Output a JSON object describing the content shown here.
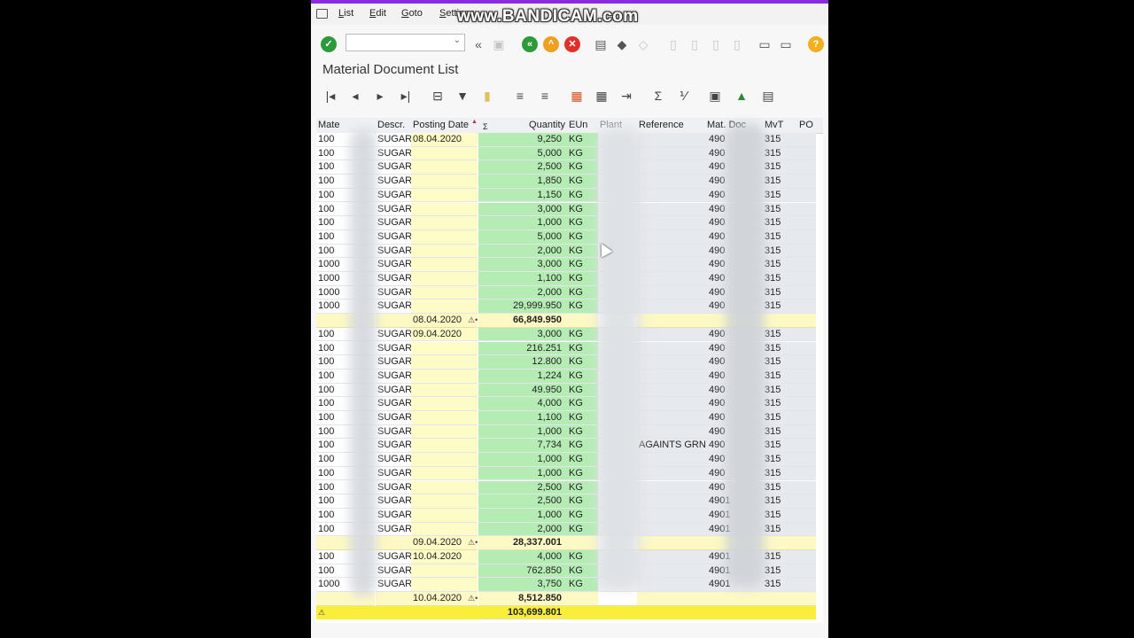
{
  "watermark": "www.BANDICAM.com",
  "menu": [
    "List",
    "Edit",
    "Goto",
    "Settings"
  ],
  "page_title": "Material Document List",
  "columns": [
    {
      "key": "material",
      "label": "Mate"
    },
    {
      "key": "descr",
      "label": "Descr."
    },
    {
      "key": "posting_date",
      "label": "Posting Date"
    },
    {
      "key": "sum_marker",
      "label": "Σ"
    },
    {
      "key": "quantity",
      "label": "Quantity"
    },
    {
      "key": "eun",
      "label": "EUn"
    },
    {
      "key": "plant",
      "label": "Plant"
    },
    {
      "key": "reference",
      "label": "Reference"
    },
    {
      "key": "mat_doc",
      "label": "Mat. Doc"
    },
    {
      "key": "mvt",
      "label": "MvT"
    },
    {
      "key": "po",
      "label": "PO"
    }
  ],
  "rows": [
    {
      "type": "item",
      "material": "100",
      "descr": "SUGAR",
      "date": "08.04.2020",
      "qty": "9,250",
      "eun": "KG",
      "ref": "",
      "matdoc": "490",
      "mvt": "315"
    },
    {
      "type": "item",
      "material": "100",
      "descr": "SUGAR",
      "date": "",
      "qty": "5,000",
      "eun": "KG",
      "ref": "",
      "matdoc": "490",
      "mvt": "315"
    },
    {
      "type": "item",
      "material": "100",
      "descr": "SUGAR",
      "date": "",
      "qty": "2,500",
      "eun": "KG",
      "ref": "",
      "matdoc": "490",
      "mvt": "315"
    },
    {
      "type": "item",
      "material": "100",
      "descr": "SUGAR",
      "date": "",
      "qty": "1,850",
      "eun": "KG",
      "ref": "",
      "matdoc": "490",
      "mvt": "315"
    },
    {
      "type": "item",
      "material": "100",
      "descr": "SUGAR",
      "date": "",
      "qty": "1,150",
      "eun": "KG",
      "ref": "",
      "matdoc": "490",
      "mvt": "315"
    },
    {
      "type": "item",
      "material": "100",
      "descr": "SUGAR",
      "date": "",
      "qty": "3,000",
      "eun": "KG",
      "ref": "",
      "matdoc": "490",
      "mvt": "315"
    },
    {
      "type": "item",
      "material": "100",
      "descr": "SUGAR",
      "date": "",
      "qty": "1,000",
      "eun": "KG",
      "ref": "",
      "matdoc": "490",
      "mvt": "315"
    },
    {
      "type": "item",
      "material": "100",
      "descr": "SUGAR",
      "date": "",
      "qty": "5,000",
      "eun": "KG",
      "ref": "",
      "matdoc": "490",
      "mvt": "315"
    },
    {
      "type": "item",
      "material": "100",
      "descr": "SUGAR",
      "date": "",
      "qty": "2,000",
      "eun": "KG",
      "ref": "",
      "matdoc": "490",
      "mvt": "315"
    },
    {
      "type": "item",
      "material": "1000",
      "descr": "SUGAR",
      "date": "",
      "qty": "3,000",
      "eun": "KG",
      "ref": "",
      "matdoc": "490",
      "mvt": "315"
    },
    {
      "type": "item",
      "material": "1000",
      "descr": "SUGAR",
      "date": "",
      "qty": "1,100",
      "eun": "KG",
      "ref": "",
      "matdoc": "490",
      "mvt": "315"
    },
    {
      "type": "item",
      "material": "1000",
      "descr": "SUGAR",
      "date": "",
      "qty": "2,000",
      "eun": "KG",
      "ref": "",
      "matdoc": "490",
      "mvt": "315"
    },
    {
      "type": "item",
      "material": "1000",
      "descr": "SUGAR",
      "date": "",
      "qty": "29,999.950",
      "eun": "KG",
      "ref": "",
      "matdoc": "490",
      "mvt": "315"
    },
    {
      "type": "subtotal",
      "date": "08.04.2020",
      "qty": "66,849.950"
    },
    {
      "type": "item",
      "material": "100",
      "descr": "SUGAR",
      "date": "09.04.2020",
      "qty": "3,000",
      "eun": "KG",
      "ref": "",
      "matdoc": "490",
      "mvt": "315"
    },
    {
      "type": "item",
      "material": "100",
      "descr": "SUGAR",
      "date": "",
      "qty": "216.251",
      "eun": "KG",
      "ref": "",
      "matdoc": "490",
      "mvt": "315"
    },
    {
      "type": "item",
      "material": "100",
      "descr": "SUGAR",
      "date": "",
      "qty": "12.800",
      "eun": "KG",
      "ref": "",
      "matdoc": "490",
      "mvt": "315"
    },
    {
      "type": "item",
      "material": "100",
      "descr": "SUGAR",
      "date": "",
      "qty": "1,224",
      "eun": "KG",
      "ref": "",
      "matdoc": "490",
      "mvt": "315"
    },
    {
      "type": "item",
      "material": "100",
      "descr": "SUGAR",
      "date": "",
      "qty": "49.950",
      "eun": "KG",
      "ref": "",
      "matdoc": "490",
      "mvt": "315"
    },
    {
      "type": "item",
      "material": "100",
      "descr": "SUGAR",
      "date": "",
      "qty": "4,000",
      "eun": "KG",
      "ref": "",
      "matdoc": "490",
      "mvt": "315"
    },
    {
      "type": "item",
      "material": "100",
      "descr": "SUGAR",
      "date": "",
      "qty": "1,100",
      "eun": "KG",
      "ref": "",
      "matdoc": "490",
      "mvt": "315"
    },
    {
      "type": "item",
      "material": "100",
      "descr": "SUGAR",
      "date": "",
      "qty": "1,000",
      "eun": "KG",
      "ref": "",
      "matdoc": "490",
      "mvt": "315"
    },
    {
      "type": "item",
      "material": "100",
      "descr": "SUGAR",
      "date": "",
      "qty": "7,734",
      "eun": "KG",
      "ref": "AGAINTS GRN",
      "matdoc": "490",
      "mvt": "315"
    },
    {
      "type": "item",
      "material": "100",
      "descr": "SUGAR",
      "date": "",
      "qty": "1,000",
      "eun": "KG",
      "ref": "",
      "matdoc": "490",
      "mvt": "315"
    },
    {
      "type": "item",
      "material": "100",
      "descr": "SUGAR",
      "date": "",
      "qty": "1,000",
      "eun": "KG",
      "ref": "",
      "matdoc": "490",
      "mvt": "315"
    },
    {
      "type": "item",
      "material": "100",
      "descr": "SUGAR",
      "date": "",
      "qty": "2,500",
      "eun": "KG",
      "ref": "",
      "matdoc": "490",
      "mvt": "315"
    },
    {
      "type": "item",
      "material": "100",
      "descr": "SUGAR",
      "date": "",
      "qty": "2,500",
      "eun": "KG",
      "ref": "",
      "matdoc": "4901",
      "mvt": "315"
    },
    {
      "type": "item",
      "material": "100",
      "descr": "SUGAR",
      "date": "",
      "qty": "1,000",
      "eun": "KG",
      "ref": "",
      "matdoc": "4901",
      "mvt": "315"
    },
    {
      "type": "item",
      "material": "100",
      "descr": "SUGAR",
      "date": "",
      "qty": "2,000",
      "eun": "KG",
      "ref": "",
      "matdoc": "4901",
      "mvt": "315"
    },
    {
      "type": "subtotal",
      "date": "09.04.2020",
      "qty": "28,337.001"
    },
    {
      "type": "item",
      "material": "100",
      "descr": "SUGAR",
      "date": "10.04.2020",
      "qty": "4,000",
      "eun": "KG",
      "ref": "",
      "matdoc": "4901",
      "mvt": "315"
    },
    {
      "type": "item",
      "material": "100",
      "descr": "SUGAR",
      "date": "",
      "qty": "762.850",
      "eun": "KG",
      "ref": "",
      "matdoc": "4901",
      "mvt": "315"
    },
    {
      "type": "item",
      "material": "1000",
      "descr": "SUGAR",
      "date": "",
      "qty": "3,750",
      "eun": "KG",
      "ref": "",
      "matdoc": "4901",
      "mvt": "315"
    },
    {
      "type": "subtotal",
      "date": "10.04.2020",
      "qty": "8,512.850"
    },
    {
      "type": "total",
      "qty": "103,699.801"
    }
  ],
  "colors": {
    "yellow_col": "#fdfbc6",
    "green_col": "#b4ecb4",
    "subtotal": "#fdf9c4",
    "total": "#f9ef3a"
  }
}
